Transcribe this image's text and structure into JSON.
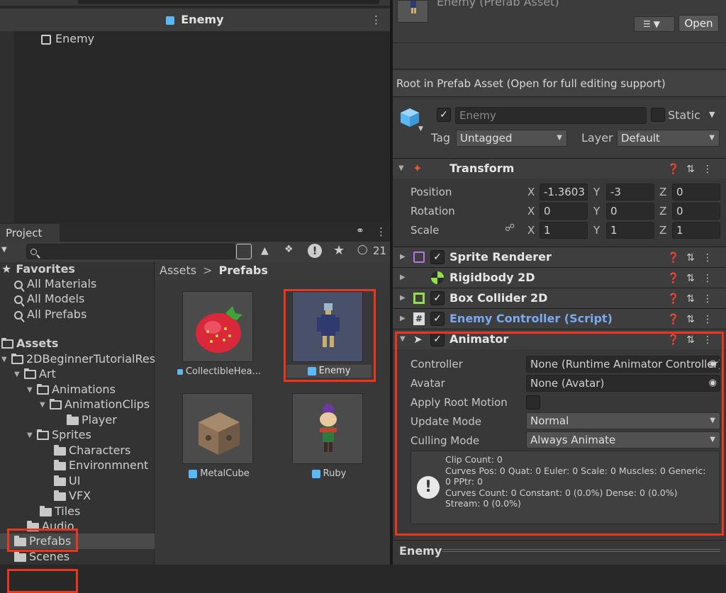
{
  "hierarchy": {
    "title": "Enemy",
    "root_item": "Enemy"
  },
  "project": {
    "tab_label": "Project",
    "search_placeholder": "",
    "hidden_count": "21",
    "favorites": {
      "label": "Favorites",
      "items": [
        "All Materials",
        "All Models",
        "All Prefabs"
      ]
    },
    "assets_tree": [
      {
        "label": "Assets",
        "depth": 0
      },
      {
        "label": "2DBeginnerTutorialResources",
        "depth": 1
      },
      {
        "label": "Art",
        "depth": 2
      },
      {
        "label": "Animations",
        "depth": 3
      },
      {
        "label": "AnimationClips",
        "depth": 4
      },
      {
        "label": "Player",
        "depth": 5
      },
      {
        "label": "Sprites",
        "depth": 3
      },
      {
        "label": "Characters",
        "depth": 4
      },
      {
        "label": "Environmnent",
        "depth": 4
      },
      {
        "label": "UI",
        "depth": 4
      },
      {
        "label": "VFX",
        "depth": 4
      },
      {
        "label": "Tiles",
        "depth": 3
      },
      {
        "label": "Audio",
        "depth": 2
      },
      {
        "label": "Prefabs",
        "depth": 1,
        "selected": true
      },
      {
        "label": "Scenes",
        "depth": 1
      }
    ],
    "breadcrumb": {
      "root": "Assets",
      "sep": ">",
      "current": "Prefabs"
    },
    "grid_items": [
      {
        "name": "CollectibleHea...",
        "icon": "strawberry"
      },
      {
        "name": "Enemy",
        "icon": "robot",
        "selected": true
      },
      {
        "name": "MetalCube",
        "icon": "metal-box"
      },
      {
        "name": "Ruby",
        "icon": "ruby-character"
      }
    ]
  },
  "inspector": {
    "asset_title": "Enemy (Prefab Asset)",
    "open_label": "Open",
    "notice": "Root in Prefab Asset (Open for full editing support)",
    "object": {
      "name": "Enemy",
      "static_label": "Static",
      "tag_label": "Tag",
      "tag_value": "Untagged",
      "layer_label": "Layer",
      "layer_value": "Default"
    },
    "transform": {
      "title": "Transform",
      "rows": [
        {
          "label": "Position",
          "x": "-1.3603",
          "y": "-3",
          "z": "0"
        },
        {
          "label": "Rotation",
          "x": "0",
          "y": "0",
          "z": "0"
        },
        {
          "label": "Scale",
          "x": "1",
          "y": "1",
          "z": "1"
        }
      ],
      "axis": {
        "x": "X",
        "y": "Y",
        "z": "Z"
      }
    },
    "components": [
      {
        "title": "Sprite Renderer",
        "checkbox": true
      },
      {
        "title": "Rigidbody 2D",
        "checkbox": false
      },
      {
        "title": "Box Collider 2D",
        "checkbox": true
      },
      {
        "title": "Enemy Controller (Script)",
        "checkbox": true,
        "link": true
      }
    ],
    "animator": {
      "title": "Animator",
      "controller_label": "Controller",
      "controller_value": "None (Runtime Animator Controller)",
      "avatar_label": "Avatar",
      "avatar_value": "None (Avatar)",
      "apply_root_label": "Apply Root Motion",
      "update_label": "Update Mode",
      "update_value": "Normal",
      "culling_label": "Culling Mode",
      "culling_value": "Always Animate",
      "info": [
        "Clip Count: 0",
        "Curves Pos: 0 Quat: 0 Euler: 0 Scale: 0 Muscles: 0 Generic:",
        "0 PPtr: 0",
        "Curves Count: 0 Constant: 0 (0.0%) Dense: 0 (0.0%)",
        "Stream: 0 (0.0%)"
      ]
    },
    "footer_title": "Enemy"
  },
  "colors": {
    "accent": "#5cb8f4",
    "highlight": "#e8371e",
    "link": "#7aa9f0"
  }
}
